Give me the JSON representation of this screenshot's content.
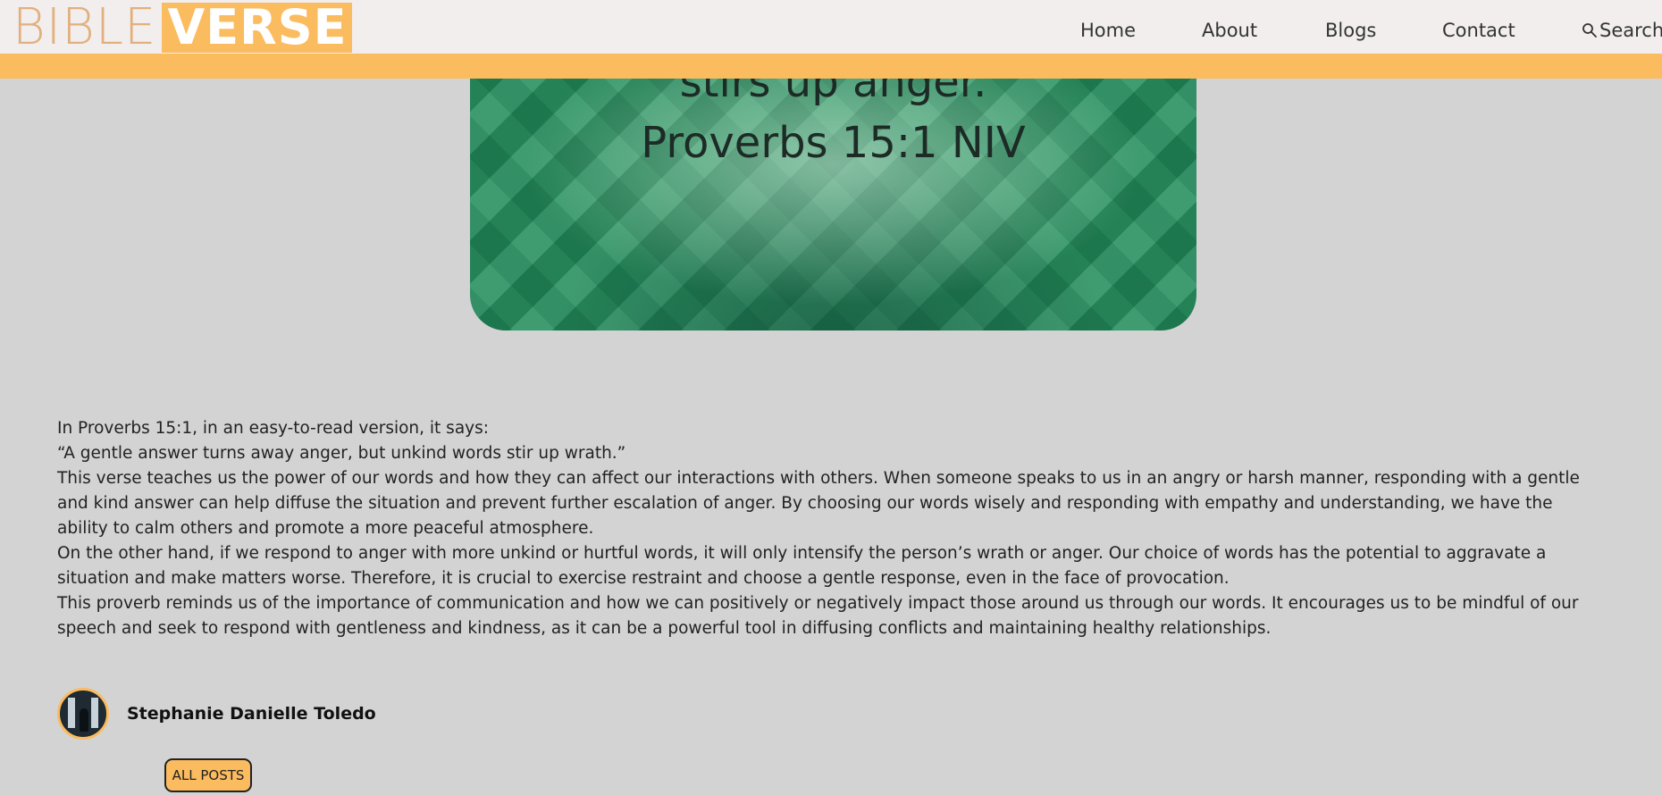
{
  "brand": {
    "logo_part1": "BIBLE",
    "logo_part2": "VERSE",
    "accent_color": "#fbbb5f",
    "header_bg": "#f2eeee",
    "page_bg": "#d3d3d3"
  },
  "nav": {
    "home": "Home",
    "about": "About",
    "blogs": "Blogs",
    "contact": "Contact",
    "search": "Search",
    "search_icon": "search-icon"
  },
  "hero": {
    "line1": "stirs up anger.",
    "line2": "Proverbs 15:1 NIV"
  },
  "article": {
    "paragraphs": [
      "In Proverbs 15:1, in an easy-to-read version, it says:",
      "“A gentle answer turns away anger, but unkind words stir up wrath.”",
      "This verse teaches us the power of our words and how they can affect our interactions with others. When someone speaks to us in an angry or harsh manner, responding with a gentle and kind answer can help diffuse the situation and prevent further escalation of anger. By choosing our words wisely and responding with empathy and understanding, we have the ability to calm others and promote a more peaceful atmosphere.",
      "On the other hand, if we respond to anger with more unkind or hurtful words, it will only intensify the person’s wrath or anger. Our choice of words has the potential to aggravate a situation and make matters worse. Therefore, it is crucial to exercise restraint and choose a gentle response, even in the face of provocation.",
      "This proverb reminds us of the importance of communication and how we can positively or negatively impact those around us through our words. It encourages us to be mindful of our speech and seek to respond with gentleness and kindness, as it can be a powerful tool in diffusing conflicts and maintaining healthy relationships."
    ]
  },
  "author": {
    "name": "Stephanie Danielle Toledo"
  },
  "buttons": {
    "all_posts": "ALL POSTS"
  }
}
